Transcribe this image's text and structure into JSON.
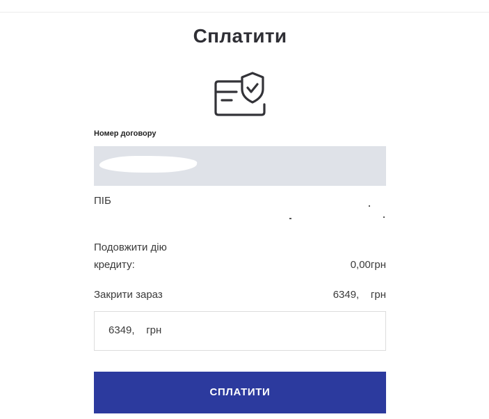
{
  "header": {
    "title": "Сплатити",
    "icon": "card-shield-check-icon"
  },
  "contract": {
    "label": "Номер договору",
    "value": ""
  },
  "fullname": {
    "label": "ПІБ"
  },
  "extend": {
    "label_line1": "Подовжити дію",
    "label_line2": "кредиту:",
    "amount": "0,00грн"
  },
  "close_now": {
    "label": "Закрити зараз",
    "amount": "6349,    грн"
  },
  "amount_input": {
    "value": "6349,    грн"
  },
  "pay_button": {
    "label": "СПЛАТИТИ"
  },
  "colors": {
    "accent": "#2c3a9e",
    "field_bg": "#dfe2e8",
    "text": "#3a3a3a"
  }
}
